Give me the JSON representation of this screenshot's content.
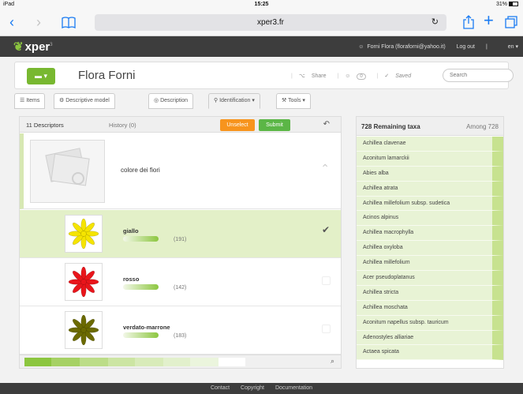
{
  "status_bar": {
    "device": "iPad",
    "time": "15:25",
    "battery": "31%"
  },
  "browser": {
    "url": "xper3.fr"
  },
  "app": {
    "logo": "xper",
    "logo_sup": "3",
    "user": "Forni Flora (floraforni@yahoo.it)",
    "logout": "Log out",
    "lang": "en"
  },
  "project": {
    "title": "Flora Forni",
    "share": "Share",
    "members": "0",
    "saved": "Saved",
    "search_placeholder": "Search"
  },
  "tabs": [
    {
      "label": "Items",
      "icon": "list-icon"
    },
    {
      "label": "Descriptive model",
      "icon": "gear-icon"
    },
    {
      "label": "Description",
      "icon": "chat-icon"
    },
    {
      "label": "Identification",
      "icon": "search-icon",
      "active": true
    },
    {
      "label": "Tools",
      "icon": "wrench-icon"
    }
  ],
  "identification": {
    "descriptors_tab": "11 Descriptors",
    "history_tab": "History (0)",
    "unselect": "Unselect",
    "submit": "Submit",
    "descriptor": {
      "name": "colore dei fiori"
    },
    "states": [
      {
        "name": "giallo",
        "count": "(191)",
        "selected": true,
        "color": "#f5e400"
      },
      {
        "name": "rosso",
        "count": "(142)",
        "selected": false,
        "color": "#e8151b"
      },
      {
        "name": "verdato-marrone",
        "count": "(183)",
        "selected": false,
        "color": "#6b6a00"
      }
    ]
  },
  "taxa": {
    "remaining": "728 Remaining taxa",
    "among": "Among 728",
    "list": [
      "Achillea clavenae",
      "Aconitum lamarckii",
      "Abies alba",
      "Achillea atrata",
      "Achillea millefolium subsp. sudetica",
      "Acinos alpinus",
      "Achillea macrophylla",
      "Achillea oxyloba",
      "Achillea millefolium",
      "Acer pseudoplatanus",
      "Achillea stricta",
      "Achillea moschata",
      "Aconitum napellus subsp. tauricum",
      "Adenostyles alliariae",
      "Actaea spicata"
    ]
  },
  "footer": {
    "contact": "Contact",
    "copyright": "Copyright",
    "documentation": "Documentation"
  },
  "colors": {
    "accent_green": "#78b830",
    "unselect_orange": "#f7941d",
    "submit_green": "#5bb646",
    "header_dark": "#3d3d3d"
  }
}
